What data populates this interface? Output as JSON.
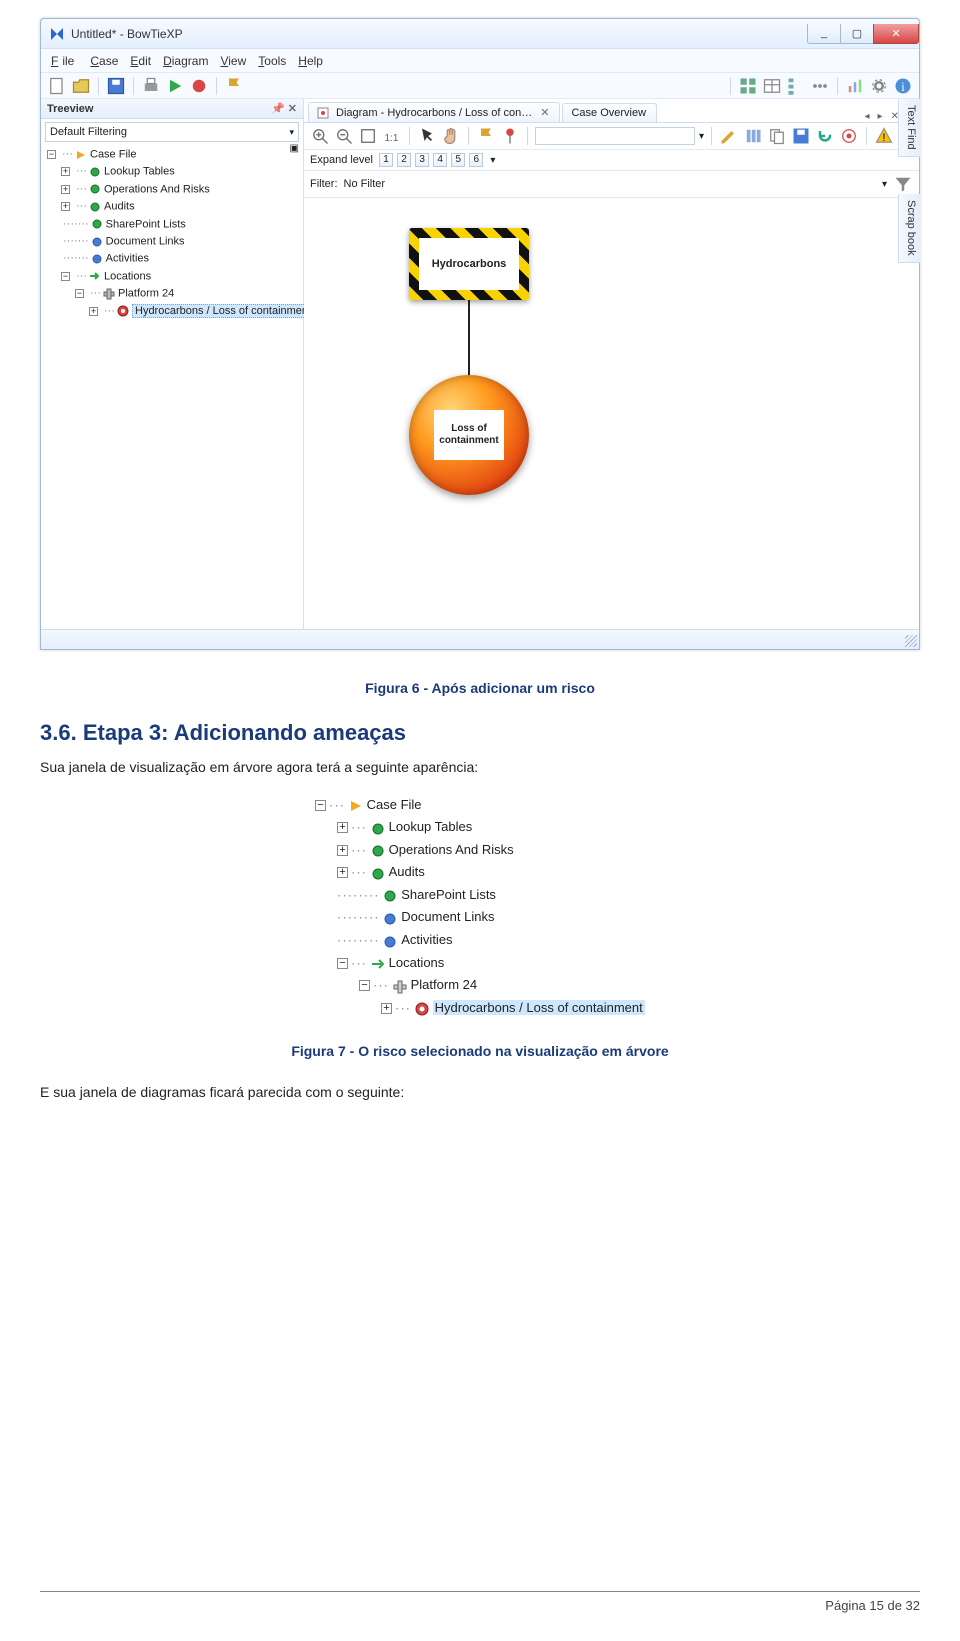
{
  "screenshot": {
    "window": {
      "title": "Untitled* - BowTieXP",
      "min_label": "_",
      "max_label": "▢",
      "close_label": "✕"
    },
    "menus": [
      "File",
      "Case",
      "Edit",
      "Diagram",
      "View",
      "Tools",
      "Help"
    ],
    "left": {
      "panel_title": "Treeview",
      "pin_glyph": "📌 ✕",
      "filter_label": "Default Filtering",
      "tree": {
        "root": "Case File",
        "items": [
          "Lookup Tables",
          "Operations And Risks",
          "Audits",
          "SharePoint Lists",
          "Document Links",
          "Activities",
          "Locations"
        ],
        "platform": "Platform 24",
        "risk": "Hydrocarbons / Loss of containment"
      }
    },
    "right": {
      "tab_diagram": "Diagram - Hydrocarbons / Loss of con…",
      "tab_overview": "Case Overview",
      "expand_label": "Expand level",
      "levels": [
        "1",
        "2",
        "3",
        "4",
        "5",
        "6"
      ],
      "filter_label": "Filter:",
      "filter_value": "No Filter",
      "hazard_text": "Hydrocarbons",
      "event_text": "Loss of containment",
      "sidetab1": "Text Find",
      "sidetab2": "Scrap book"
    }
  },
  "doc": {
    "caption1": "Figura 6 - Após adicionar um risco",
    "section_no": "3.6.",
    "section_title": "Etapa 3: Adicionando ameaças",
    "para1": "Sua janela de visualização em árvore agora terá a seguinte aparência:",
    "caption2": "Figura 7 - O risco selecionado na visualização em árvore",
    "para2": "E sua janela de diagramas ficará parecida com o seguinte:",
    "footer": "Página 15 de 32"
  },
  "treefig": {
    "root": "Case File",
    "items": [
      "Lookup Tables",
      "Operations And Risks",
      "Audits",
      "SharePoint Lists",
      "Document Links",
      "Activities",
      "Locations"
    ],
    "platform": "Platform 24",
    "risk": "Hydrocarbons / Loss of containment"
  }
}
